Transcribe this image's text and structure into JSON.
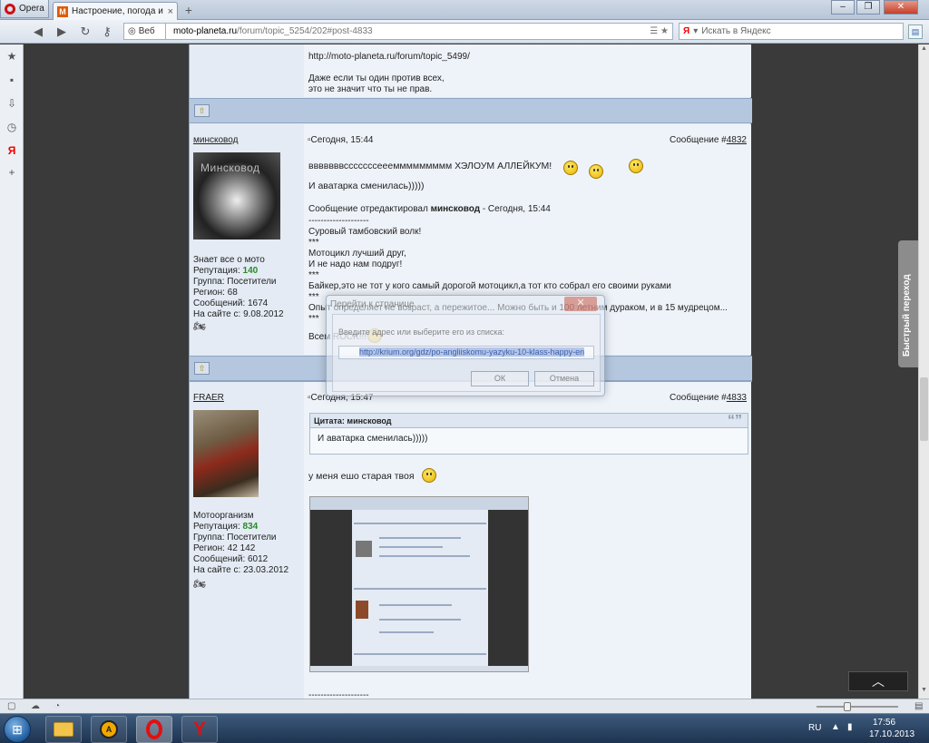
{
  "browser": {
    "menu_label": "Opera",
    "tab_title": "Настроение, погода и ...",
    "tab_close": "×",
    "new_tab": "+",
    "win_min": "‒",
    "win_max": "❐",
    "win_close": "✕",
    "web_label": "Веб",
    "url_host": "moto-planeta.ru",
    "url_path": "/forum/topic_5254/202#post-4833",
    "search_placeholder": "Искать в Яндекс",
    "search_engine": "Я",
    "quick_pane_label": "Быстрый переход",
    "to_top": "︿"
  },
  "forum": {
    "top_lines": [
      "http://moto-planeta.ru/forum/topic_5499/",
      "Даже если ты один против всех,",
      "это не значит что ты не прав."
    ],
    "up_icon": "⇧",
    "posts": [
      {
        "author": "минсковод",
        "avatar_text": "Минсковод",
        "date": "Сегодня, 15:44",
        "msg_label": "Сообщение #",
        "msg_num": "4832",
        "rank": "Знает все о мото",
        "rep_label": "Репутация:",
        "rep": "140",
        "group": "Группа: Посетители",
        "region": "Регион: 68",
        "messages": "Сообщений: 1674",
        "since": "На сайте с: 9.08.2012",
        "lines": [
          "вввввввсссссссеееммммммммм ХЭЛОУМ АЛЛЕЙКУМ!",
          "И аватарка сменилась)))))"
        ],
        "edited_prefix": "Сообщение отредактировал ",
        "edited_by": "минсковод",
        "edited_suffix": " - Сегодня, 15:44",
        "sig": [
          "--------------------",
          "Суровый тамбовский волк!",
          "***",
          "Мотоцикл лучший друг,",
          "И не надо нам подруг!",
          "***",
          "Байкер,это не тот у кого самый дорогой мотоцикл,а тот кто собрал его своими руками",
          "***",
          "Опыт определяет не возраст, а пережитое... Можно быть и 100 летним дураком, и в 15 мудрецом...",
          "***",
          "Всем ROCK!!!"
        ]
      },
      {
        "author": "FRAER",
        "date": "Сегодня, 15:47",
        "msg_label": "Сообщение #",
        "msg_num": "4833",
        "rank": "Мотоорганизм",
        "rep_label": "Репутация:",
        "rep": "834",
        "group": "Группа: Посетители",
        "region": "Регион: 42 142",
        "messages": "Сообщений: 6012",
        "since": "На сайте с: 23.03.2012",
        "quote_label": "Цитата: минсковод",
        "quote_mark": "“”",
        "quote_text": "И аватарка сменилась)))))",
        "body": "у меня ешо старая твоя",
        "footer": "--------------------"
      }
    ]
  },
  "dialog": {
    "title": "Перейти к странице",
    "close": "✕",
    "prompt": "Введите адрес или выберите его из списка:",
    "value": "http://krium.org/gdz/po-angliiskomu-yazyku-10-klass-happy-en",
    "ok": "ОК",
    "cancel": "Отмена"
  },
  "taskbar": {
    "aimp_label": "A",
    "yandex_label": "Y",
    "lang": "RU",
    "time": "17:56",
    "date": "17.10.2013"
  }
}
